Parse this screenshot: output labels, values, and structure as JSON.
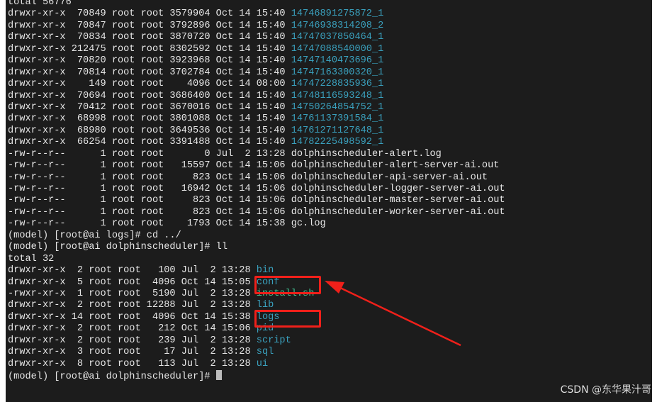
{
  "terminal": {
    "lines": [
      {
        "text": "total 56776"
      },
      {
        "text": "drwxr-xr-x  70849 root root 3579904 Oct 14 15:40 ",
        "name": "14746891275872_1",
        "kind": "dir"
      },
      {
        "text": "drwxr-xr-x  70847 root root 3792896 Oct 14 15:40 ",
        "name": "14746938314208_2",
        "kind": "dir"
      },
      {
        "text": "drwxr-xr-x  70834 root root 3870720 Oct 14 15:40 ",
        "name": "14747037850464_1",
        "kind": "dir"
      },
      {
        "text": "drwxr-xr-x 212475 root root 8302592 Oct 14 15:40 ",
        "name": "14747088540000_1",
        "kind": "dir"
      },
      {
        "text": "drwxr-xr-x  70820 root root 3923968 Oct 14 15:40 ",
        "name": "14747140473696_1",
        "kind": "dir"
      },
      {
        "text": "drwxr-xr-x  70814 root root 3702784 Oct 14 15:40 ",
        "name": "14747163300320_1",
        "kind": "dir"
      },
      {
        "text": "drwxr-xr-x    149 root root    4096 Oct 14 08:00 ",
        "name": "14747228835936_1",
        "kind": "dir"
      },
      {
        "text": "drwxr-xr-x  70694 root root 3686400 Oct 14 15:40 ",
        "name": "14748116593248_1",
        "kind": "dir"
      },
      {
        "text": "drwxr-xr-x  70412 root root 3670016 Oct 14 15:40 ",
        "name": "14750264854752_1",
        "kind": "dir"
      },
      {
        "text": "drwxr-xr-x  68998 root root 3801088 Oct 14 15:40 ",
        "name": "14761137391584_1",
        "kind": "dir"
      },
      {
        "text": "drwxr-xr-x  68980 root root 3649536 Oct 14 15:40 ",
        "name": "14761271127648_1",
        "kind": "dir"
      },
      {
        "text": "drwxr-xr-x  66254 root root 3391488 Oct 14 15:40 ",
        "name": "14782225498592_1",
        "kind": "dir"
      },
      {
        "text": "-rw-r--r--      1 root root       0 Jul  2 13:28 ",
        "name": "dolphinscheduler-alert.log",
        "kind": "file"
      },
      {
        "text": "-rw-r--r--      1 root root   15597 Oct 14 15:06 ",
        "name": "dolphinscheduler-alert-server-ai.out",
        "kind": "file"
      },
      {
        "text": "-rw-r--r--      1 root root     823 Oct 14 15:06 ",
        "name": "dolphinscheduler-api-server-ai.out",
        "kind": "file"
      },
      {
        "text": "-rw-r--r--      1 root root   16942 Oct 14 15:06 ",
        "name": "dolphinscheduler-logger-server-ai.out",
        "kind": "file"
      },
      {
        "text": "-rw-r--r--      1 root root     823 Oct 14 15:06 ",
        "name": "dolphinscheduler-master-server-ai.out",
        "kind": "file"
      },
      {
        "text": "-rw-r--r--      1 root root     823 Oct 14 15:06 ",
        "name": "dolphinscheduler-worker-server-ai.out",
        "kind": "file"
      },
      {
        "text": "-rw-r--r--      1 root root    1793 Oct 14 15:38 ",
        "name": "gc.log",
        "kind": "file"
      },
      {
        "text": "(model) [root@ai logs]# cd ../"
      },
      {
        "text": "(model) [root@ai dolphinscheduler]# ll"
      },
      {
        "text": "total 32"
      },
      {
        "text": "drwxr-xr-x  2 root root   100 Jul  2 13:28 ",
        "name": "bin",
        "kind": "dir"
      },
      {
        "text": "drwxr-xr-x  5 root root  4096 Oct 14 15:05 ",
        "name": "conf",
        "kind": "dir"
      },
      {
        "text": "-rwxr-xr-x  1 root root  5190 Jul  2 13:28 ",
        "name": "install.sh",
        "kind": "exe"
      },
      {
        "text": "drwxr-xr-x  2 root root 12288 Jul  2 13:28 ",
        "name": "lib",
        "kind": "dir"
      },
      {
        "text": "drwxr-xr-x 14 root root  4096 Oct 14 15:38 ",
        "name": "logs",
        "kind": "dir"
      },
      {
        "text": "drwxr-xr-x  2 root root   212 Oct 14 15:06 ",
        "name": "pid",
        "kind": "dir"
      },
      {
        "text": "drwxr-xr-x  2 root root   239 Jul  2 13:28 ",
        "name": "script",
        "kind": "dir"
      },
      {
        "text": "drwxr-xr-x  3 root root    17 Jul  2 13:28 ",
        "name": "sql",
        "kind": "dir"
      },
      {
        "text": "drwxr-xr-x  8 root root   113 Jul  2 13:28 ",
        "name": "ui",
        "kind": "dir"
      },
      {
        "text": "(model) [root@ai dolphinscheduler]# ",
        "cursor": true
      }
    ]
  },
  "watermark": "CSDN @东华果汁哥",
  "colors": {
    "directory": "#3aa0bd",
    "executable": "#3fbf8f",
    "annotation": "#f0201a",
    "background": "#1c1c1c"
  }
}
